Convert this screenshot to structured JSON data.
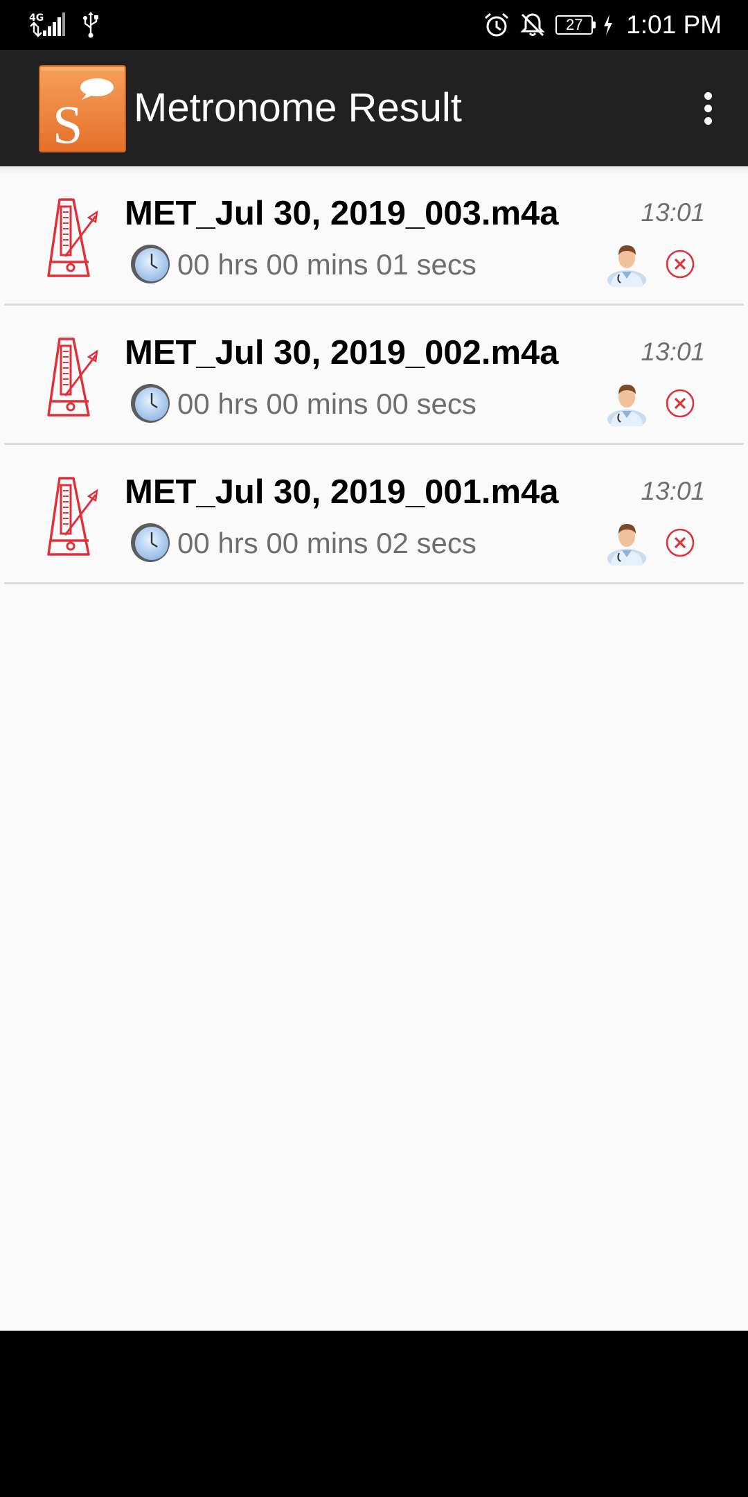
{
  "status_bar": {
    "network_label": "4G",
    "battery_level": "27",
    "time": "1:01 PM"
  },
  "app_bar": {
    "title": "Metronome Result",
    "logo_letter": "S",
    "menu_icon": "more-vert-icon"
  },
  "recordings": [
    {
      "filename": "MET_Jul 30, 2019_003.m4a",
      "time": "13:01",
      "duration": "00 hrs 00 mins 01 secs"
    },
    {
      "filename": "MET_Jul 30, 2019_002.m4a",
      "time": "13:01",
      "duration": "00 hrs 00 mins 00 secs"
    },
    {
      "filename": "MET_Jul 30, 2019_001.m4a",
      "time": "13:01",
      "duration": "00 hrs 00 mins 02 secs"
    }
  ],
  "colors": {
    "app_bar_bg": "#212121",
    "logo_orange": "#f08a3c",
    "metronome_red": "#e0303a",
    "content_bg": "#fafafa",
    "secondary_text": "#6e6e6e"
  }
}
